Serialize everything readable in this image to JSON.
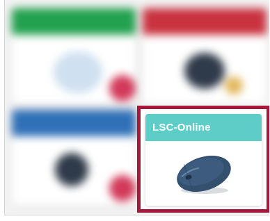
{
  "colors": {
    "tile_green": "#22a14e",
    "tile_red": "#c9323f",
    "tile_blue": "#2f70b7",
    "tile_teal": "#5ecdc8",
    "highlight_border": "#a6173c",
    "mouse_body": "#34506f"
  },
  "tiles": [
    {
      "color_key": "tile_green",
      "blurred": true
    },
    {
      "color_key": "tile_red",
      "blurred": true
    },
    {
      "color_key": "tile_blue",
      "blurred": true
    }
  ],
  "highlighted_tile": {
    "title": "LSC-Online",
    "icon": "computer-mouse-icon"
  }
}
